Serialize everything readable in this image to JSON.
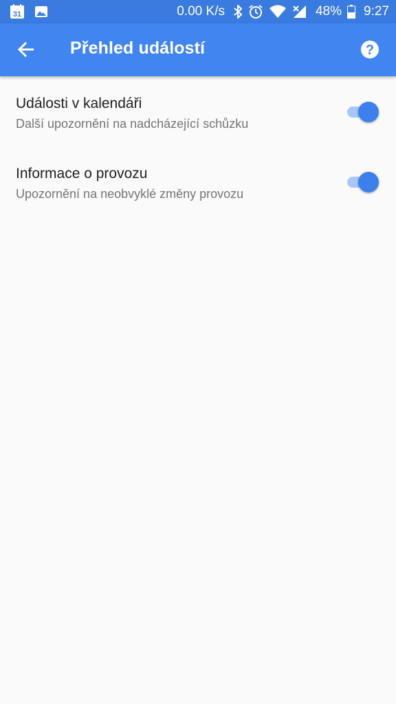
{
  "status_bar": {
    "calendar_day": "31",
    "net_speed": "0.00 K/s",
    "battery": "48%",
    "time": "9:27",
    "icons": [
      "calendar-icon",
      "image-icon",
      "bluetooth-icon",
      "alarm-icon",
      "wifi-icon",
      "cellular-icon",
      "battery-icon"
    ]
  },
  "app_bar": {
    "title": "Přehled událostí",
    "back_icon": "arrow-back-icon",
    "help_icon": "help-icon"
  },
  "settings": [
    {
      "title": "Události v kalendáři",
      "subtitle": "Další upozornění na nadcházející schůzku",
      "enabled": true
    },
    {
      "title": "Informace o provozu",
      "subtitle": "Upozornění na neobvyklé změny provozu",
      "enabled": true
    }
  ],
  "colors": {
    "status_bar": "#3a7be0",
    "app_bar": "#4185f0",
    "toggle_thumb": "#3d80ec",
    "toggle_track": "#a9c6f4",
    "background": "#fafafa"
  }
}
